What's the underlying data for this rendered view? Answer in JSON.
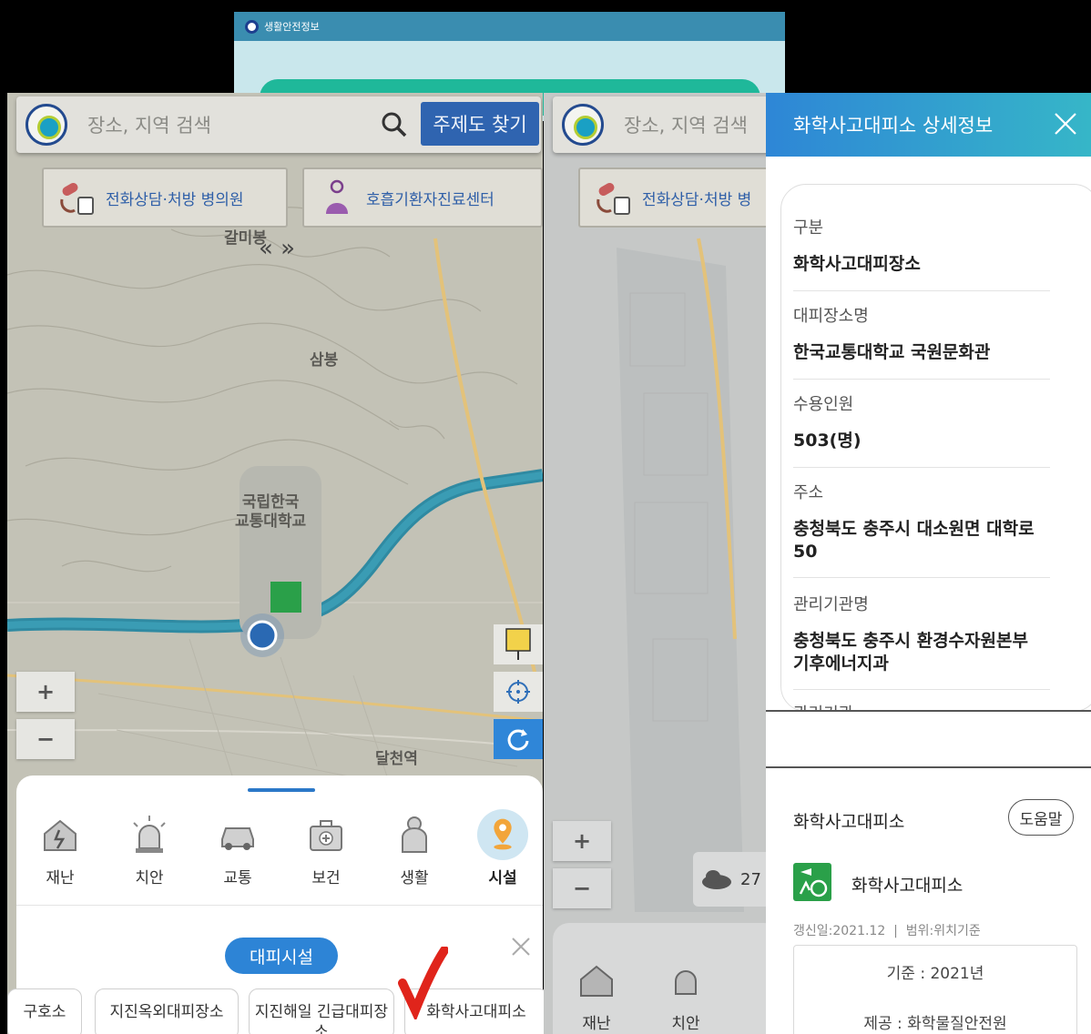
{
  "top_window": {
    "title": "생활안전정보"
  },
  "left_panel": {
    "search": {
      "placeholder": "장소, 지역 검색",
      "theme_button": "주제도 찾기"
    },
    "chips": [
      {
        "label": "전화상담·처방 병의원"
      },
      {
        "label": "호흡기환자진료센터"
      }
    ],
    "map_labels": {
      "galmi": "갈미봉",
      "sambong": "삼봉",
      "univ": "국립한국\n교통대학교",
      "station": "달천역"
    },
    "zoom": {
      "in": "+",
      "out": "−"
    },
    "categories": [
      {
        "label": "재난",
        "icon": "disaster-icon"
      },
      {
        "label": "치안",
        "icon": "siren-icon"
      },
      {
        "label": "교통",
        "icon": "car-icon"
      },
      {
        "label": "보건",
        "icon": "medical-kit-icon"
      },
      {
        "label": "생활",
        "icon": "person-icon"
      },
      {
        "label": "시설",
        "icon": "location-pin-icon",
        "active": true
      }
    ],
    "evac_button": "대피시설",
    "facilities": [
      "구호소",
      "지진옥외대피장소",
      "지진해일 긴급대피장소",
      "화학사고대피소"
    ]
  },
  "middle_panel": {
    "search": {
      "placeholder": "장소, 지역 검색"
    },
    "chip": "전화상담·처방 병",
    "weather_temp": "27",
    "categories": [
      "재난",
      "치안"
    ]
  },
  "detail": {
    "title": "화학사고대피소 상세정보",
    "fields": [
      {
        "label": "구분",
        "value": "화학사고대피장소"
      },
      {
        "label": "대피장소명",
        "value": "한국교통대학교 국원문화관"
      },
      {
        "label": "수용인원",
        "value": "503(명)"
      },
      {
        "label": "주소",
        "value": "충청북도 충주시 대소원면 대학로 50"
      },
      {
        "label": "관리기관명",
        "value": "충청북도 충주시 환경수자원본부 기후에너지과"
      }
    ],
    "truncated_label": "관리기관",
    "lower_title": "화학사고대피소",
    "help": "도움말",
    "facility_name": "화학사고대피소",
    "meta": "갱신일:2021.12  |  범위:위치기준",
    "base": "기준 : 2021년",
    "provider": "제공 : 화학물질안전원"
  },
  "colors": {
    "accent_blue": "#2f64b0",
    "header_gradient_start": "#2e86d6",
    "header_gradient_end": "#36b6c8",
    "river": "#2f8aa2",
    "check_mark": "#e0241b"
  }
}
